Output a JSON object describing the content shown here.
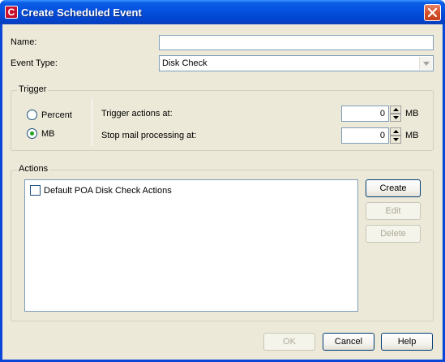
{
  "window": {
    "title": "Create Scheduled Event",
    "icon": "app-logo-icon"
  },
  "form": {
    "name_label": "Name:",
    "name_value": "",
    "event_type_label": "Event Type:",
    "event_type_value": "Disk Check"
  },
  "trigger": {
    "group_label": "Trigger",
    "radio_percent_label": "Percent",
    "radio_mb_label": "MB",
    "selected": "MB",
    "trigger_actions_label": "Trigger actions at:",
    "trigger_actions_value": "0",
    "trigger_actions_unit": "MB",
    "stop_mail_label": "Stop mail processing at:",
    "stop_mail_value": "0",
    "stop_mail_unit": "MB"
  },
  "actions": {
    "group_label": "Actions",
    "items": [
      {
        "label": "Default POA Disk Check Actions",
        "checked": false
      }
    ],
    "create_label": "Create",
    "edit_label": "Edit",
    "delete_label": "Delete"
  },
  "footer": {
    "ok_label": "OK",
    "cancel_label": "Cancel",
    "help_label": "Help"
  }
}
